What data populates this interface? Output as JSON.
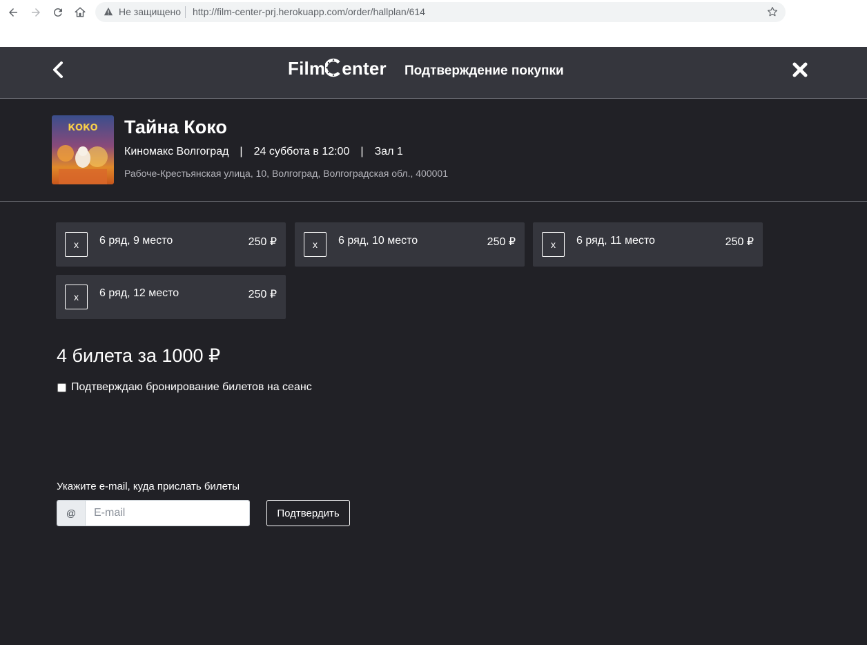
{
  "browser": {
    "security_label": "Не защищено",
    "url": "http://film-center-prj.herokuapp.com/order/hallplan/614"
  },
  "header": {
    "logo_left": "Film",
    "logo_right": "enter",
    "title": "Подтверждение покупки"
  },
  "film": {
    "title": "Тайна Коко",
    "cinema": "Киномакс Волгоград",
    "separator": "|",
    "datetime": "24 суббота в 12:00",
    "hall": "Зал 1",
    "address": "Рабоче-Крестьянская улица, 10, Волгоград, Волгоградская обл., 400001",
    "poster_text": "КОКО"
  },
  "tickets": [
    {
      "remove_label": "x",
      "seat": "6 ряд, 9 место",
      "price": "250 ₽"
    },
    {
      "remove_label": "x",
      "seat": "6 ряд, 10 место",
      "price": "250 ₽"
    },
    {
      "remove_label": "x",
      "seat": "6 ряд, 11 место",
      "price": "250 ₽"
    },
    {
      "remove_label": "x",
      "seat": "6 ряд, 12 место",
      "price": "250 ₽"
    }
  ],
  "summary": {
    "total": "4 билета за 1000 ₽",
    "confirm_label": "Подтверждаю бронирование билетов на сеанс",
    "confirm_checked": false
  },
  "email": {
    "label": "Укажите e-mail, куда прислать билеты",
    "prefix": "@",
    "placeholder": "E-mail",
    "value": "",
    "submit_label": "Подтвердить"
  },
  "colors": {
    "page_bg": "#212126",
    "header_bg": "#35363d",
    "card_bg": "#35363d",
    "text": "#ffffff",
    "muted_text": "#b3b3ba"
  }
}
